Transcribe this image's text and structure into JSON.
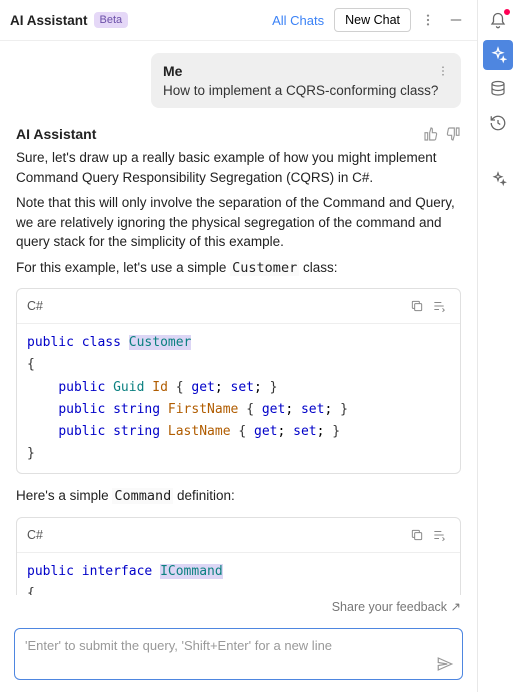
{
  "header": {
    "title": "AI Assistant",
    "badge": "Beta",
    "all_chats": "All Chats",
    "new_chat": "New Chat"
  },
  "user": {
    "name": "Me",
    "message": "How to implement a CQRS-conforming class?"
  },
  "ai": {
    "name": "AI Assistant",
    "p1": "Sure, let's draw up a really basic example of how you might implement Command Query Responsibility Segregation (CQRS) in C#.",
    "p2": "Note that this will only involve the separation of the Command and Query, we are relatively ignoring the physical segregation of the command and query stack for the simplicity of this example.",
    "p3a": "For this example, let's use a simple ",
    "p3code": "Customer",
    "p3b": " class:",
    "p4a": "Here's a simple ",
    "p4code": "Command",
    "p4b": " definition:"
  },
  "code1": {
    "lang": "C#"
  },
  "code2": {
    "lang": "C#"
  },
  "feedback": "Share your feedback ↗",
  "input": {
    "placeholder": "'Enter' to submit the query, 'Shift+Enter' for a new line"
  }
}
